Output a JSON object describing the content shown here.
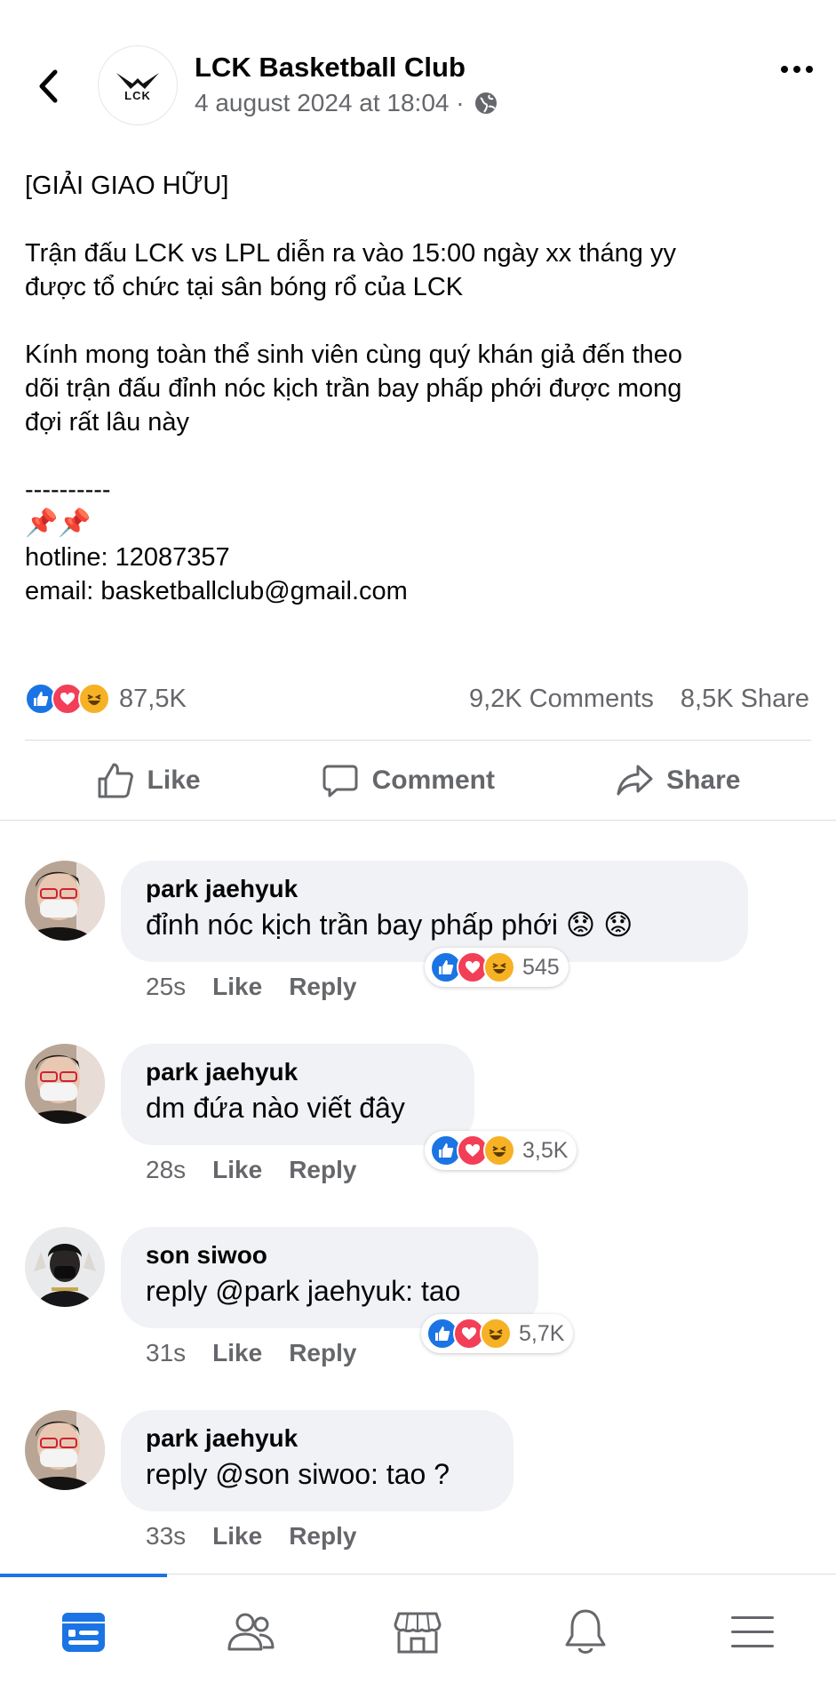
{
  "header": {
    "page_name": "LCK Basketball Club",
    "timestamp": "4 august 2024 at 18:04 ·",
    "avatar_text": "LCK",
    "back_icon": "chevron-left-icon",
    "more_icon": "more-horizontal-icon",
    "privacy_icon": "globe-icon"
  },
  "post": {
    "lines": [
      "[GIẢI GIAO HỮU]",
      "",
      "Trận đấu LCK vs LPL diễn ra vào 15:00 ngày xx tháng yy",
      "được tổ chức tại sân bóng rổ của LCK",
      "",
      "Kính mong toàn thể sinh viên cùng quý khán giả đến theo",
      "dõi trận đấu đỉnh nóc kịch trần bay phấp phới được mong",
      "đợi rất lâu này",
      "",
      "----------"
    ],
    "pins": "📌📌",
    "hotline": "hotline: 12087357",
    "email": "email: basketballclub@gmail.com"
  },
  "stats": {
    "reactions": "87,5K",
    "comments": "9,2K Comments",
    "shares": "8,5K Share"
  },
  "actions": {
    "like": "Like",
    "comment": "Comment",
    "share": "Share"
  },
  "comments": [
    {
      "name": "park jaehyuk",
      "text": "đỉnh nóc kịch trần bay phấp phới 😟 😟",
      "reactions": "545",
      "time": "25s",
      "like": "Like",
      "reply": "Reply"
    },
    {
      "name": "park jaehyuk",
      "text": "dm đứa nào viết đây",
      "reactions": "3,5K",
      "time": "28s",
      "like": "Like",
      "reply": "Reply"
    },
    {
      "name": "son siwoo",
      "text": "reply @park jaehyuk: tao",
      "reactions": "5,7K",
      "time": "31s",
      "like": "Like",
      "reply": "Reply"
    },
    {
      "name": "park jaehyuk",
      "text": "reply @son siwoo: tao ?",
      "time": "33s",
      "like": "Like",
      "reply": "Reply"
    }
  ],
  "nav": {
    "items": [
      "feed-icon",
      "friends-icon",
      "marketplace-icon",
      "notifications-icon",
      "menu-icon"
    ],
    "active": "feed-icon"
  },
  "colors": {
    "accent": "#1b74e4",
    "love": "#f33e58",
    "haha": "#f7b125",
    "secondary_text": "#65676b",
    "bubble": "#f0f2f5"
  }
}
